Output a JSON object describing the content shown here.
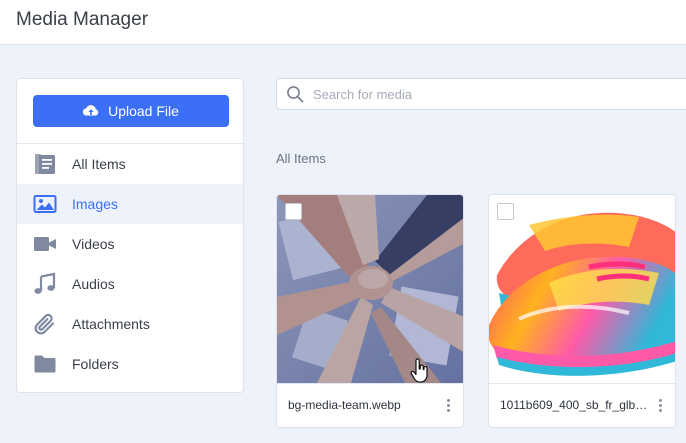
{
  "app": {
    "title": "Media Manager"
  },
  "sidebar": {
    "upload_label": "Upload File",
    "items": [
      {
        "label": "All Items",
        "icon": "documents-icon",
        "active": false
      },
      {
        "label": "Images",
        "icon": "image-icon",
        "active": true
      },
      {
        "label": "Videos",
        "icon": "video-icon",
        "active": false
      },
      {
        "label": "Audios",
        "icon": "music-icon",
        "active": false
      },
      {
        "label": "Attachments",
        "icon": "paperclip-icon",
        "active": false
      },
      {
        "label": "Folders",
        "icon": "folder-icon",
        "active": false
      }
    ]
  },
  "search": {
    "placeholder": "Search for media",
    "value": ""
  },
  "main": {
    "section_title": "All Items",
    "media": [
      {
        "filename": "bg-media-team.webp",
        "thumbnail": "team-hands-photo"
      },
      {
        "filename": "1011b609_400_sb_fr_glb.w...",
        "thumbnail": "colorful-sneaker-photo"
      }
    ]
  },
  "colors": {
    "accent": "#3b6ff5",
    "background": "#eef2fa",
    "sidebar_active_bg": "#eef2fa"
  }
}
